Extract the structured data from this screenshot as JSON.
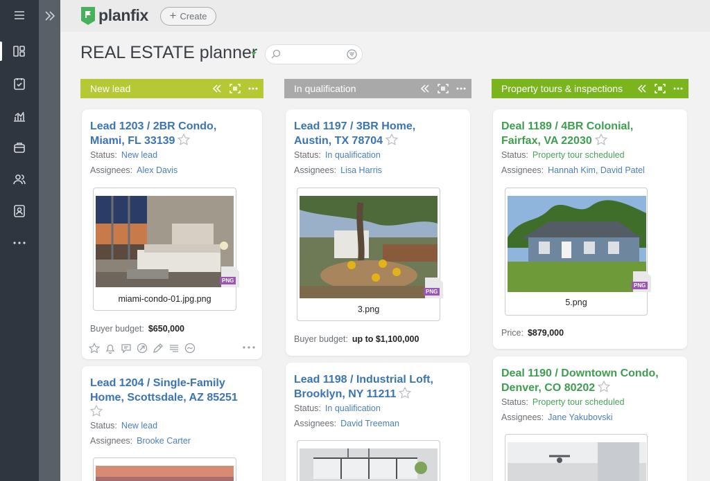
{
  "app": {
    "logo_text": "planfix",
    "create_label": "Create",
    "accent": "#46b15a"
  },
  "page": {
    "title": "REAL ESTATE planner"
  },
  "search": {
    "placeholder": ""
  },
  "nav": {
    "items": [
      "menu-icon",
      "planner-icon",
      "tasks-icon",
      "analytics-icon",
      "projects-icon",
      "contacts-icon",
      "employees-icon",
      "more-icon"
    ]
  },
  "columns": [
    {
      "name": "New lead",
      "color": "#b6c935",
      "cards": [
        {
          "title_line1": "Lead 1203 / 2BR Condo,",
          "title_line2": "Miami, FL 33139",
          "status_label": "Status:",
          "status": "New lead",
          "assignees_label": "Assignees:",
          "assignees": "Alex Davis",
          "file": {
            "name": "miami-condo-01.jpg.png",
            "badge": "PNG"
          },
          "field_label": "Buyer budget:",
          "field_value": "$650,000"
        },
        {
          "title_line1": "Lead 1204 / Single-Family",
          "title_line2": "Home, Scottsdale, AZ 85251",
          "status_label": "Status:",
          "status": "New lead",
          "assignees_label": "Assignees:",
          "assignees": "Brooke Carter"
        }
      ]
    },
    {
      "name": "In qualification",
      "color": "#a9a9a9",
      "cards": [
        {
          "title_line1": "Lead 1197 / 3BR Home,",
          "title_line2": "Austin, TX 78704",
          "status_label": "Status:",
          "status": "In qualification",
          "assignees_label": "Assignees:",
          "assignees": "Lisa Harris",
          "file": {
            "name": "3.png",
            "badge": "PNG"
          },
          "field_label": "Buyer budget:",
          "field_value": "up to $1,100,000"
        },
        {
          "title_line1": "Lead 1198 / Industrial Loft,",
          "title_line2": "Brooklyn, NY 11211",
          "status_label": "Status:",
          "status": "In qualification",
          "assignees_label": "Assignees:",
          "assignees": "David Treeman"
        }
      ]
    },
    {
      "name": "Property tours & inspections",
      "color": "#7ab51d",
      "cards": [
        {
          "title_line1": "Deal 1189 / 4BR Colonial,",
          "title_line2": "Fairfax, VA 22030",
          "status_label": "Status:",
          "status": "Property tour scheduled",
          "assignees_label": "Assignees:",
          "assignees": "Hannah Kim, David Patel",
          "file": {
            "name": "5.png",
            "badge": "PNG"
          },
          "field_label": "Price:",
          "field_value": "$879,000"
        },
        {
          "title_line1": "Deal 1190 / Downtown Condo,",
          "title_line2": "Denver, CO 80202",
          "status_label": "Status:",
          "status": "Property tour scheduled",
          "assignees_label": "Assignees:",
          "assignees": "Jane Yakubovski"
        }
      ]
    }
  ]
}
